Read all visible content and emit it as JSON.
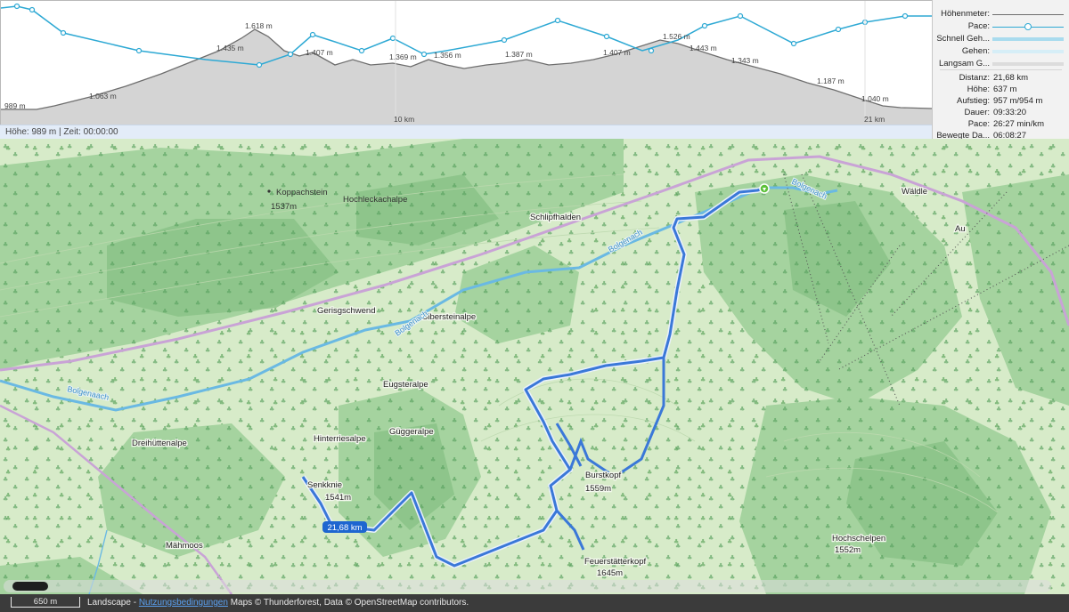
{
  "profile": {
    "elevation_labels": [
      "1.618 m",
      "1.435 m",
      "1.407 m",
      "1.369 m",
      "1.356 m",
      "1.387 m",
      "1.407 m",
      "1.526 m",
      "1.443 m",
      "1.343 m",
      "1.187 m",
      "1.040 m",
      "1.063 m",
      "989 m"
    ],
    "distance_labels": [
      "10 km",
      "21 km"
    ],
    "status": "Höhe: 989 m | Zeit: 00:00:00",
    "colors": {
      "elevation_fill": "#d4d4d4",
      "elevation_line": "#6e6e6e",
      "pace_line": "#2ea9d4"
    }
  },
  "legend": {
    "items": [
      {
        "label": "Höhenmeter:",
        "swatch": "#6e6e6e"
      },
      {
        "label": "Pace:",
        "swatch": "#2ea9d4"
      },
      {
        "label": "Schnell Geh...",
        "swatch": "#a9dbee"
      },
      {
        "label": "Gehen:",
        "swatch": "#d6eef7"
      },
      {
        "label": "Langsam G...",
        "swatch": "#dcdcdc"
      }
    ]
  },
  "stats": [
    {
      "label": "Distanz:",
      "value": "21,68 km"
    },
    {
      "label": "Höhe:",
      "value": "637 m"
    },
    {
      "label": "Aufstieg:",
      "value": "957 m/954 m"
    },
    {
      "label": "Dauer:",
      "value": "09:33:20"
    },
    {
      "label": "Pace:",
      "value": "26:27 min/km"
    },
    {
      "label": "Bewegte Da...",
      "value": "06:08:27"
    }
  ],
  "map": {
    "places": [
      {
        "name": "Koppachstein"
      },
      {
        "name": "1537m"
      },
      {
        "name": "Hochleckachalpe"
      },
      {
        "name": "Schlipfhalden"
      },
      {
        "name": "Wäldle"
      },
      {
        "name": "Au"
      },
      {
        "name": "Gerisgschwend"
      },
      {
        "name": "Bibersteinalpe"
      },
      {
        "name": "Eugsteralpe"
      },
      {
        "name": "Dreihüttenalpe"
      },
      {
        "name": "Hinterriesalpe"
      },
      {
        "name": "Güggeralpe"
      },
      {
        "name": "Burstkopf"
      },
      {
        "name": "1559m"
      },
      {
        "name": "Feuerstätterkopf"
      },
      {
        "name": "1645m"
      },
      {
        "name": "Hochschelpen"
      },
      {
        "name": "1552m"
      },
      {
        "name": "Mähmoos"
      },
      {
        "name": "Senkknie"
      },
      {
        "name": "1541m"
      }
    ],
    "rivers": [
      "Bolgenach",
      "Bolgenach",
      "Bolgenach",
      "Bolgenaach"
    ],
    "track_label": "21,68 km",
    "colors": {
      "forest": "#9fcf9a",
      "meadow": "#d7ebc9",
      "river": "#6ab9e3",
      "road": "#c9a3d6",
      "track": "#3a78d8",
      "start_marker": "#5cc13a"
    }
  },
  "footer": {
    "scale": "650 m",
    "attribution_prefix": "Landscape - ",
    "attribution_link": "Nutzungsbedingungen",
    "attribution_suffix": " Maps © Thunderforest, Data © OpenStreetMap contributors."
  }
}
